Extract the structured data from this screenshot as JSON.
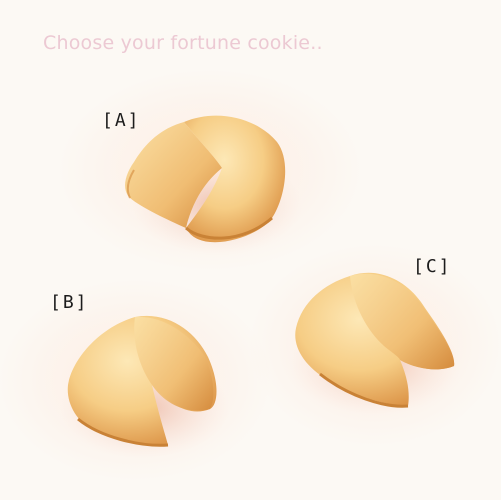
{
  "prompt": "Choose your fortune cookie..",
  "options": [
    {
      "label": "[A]",
      "icon": "fortune-cookie-icon"
    },
    {
      "label": "[B]",
      "icon": "fortune-cookie-icon"
    },
    {
      "label": "[C]",
      "icon": "fortune-cookie-icon"
    }
  ],
  "colors": {
    "background": "#fcf9f4",
    "prompt_text": "#ecc9d3",
    "label_text": "#1c1c1c",
    "cookie_light": "#fbe4ae",
    "cookie_mid": "#f3c27a",
    "cookie_dark": "#d98f3f",
    "cookie_shadow": "#e8a48c"
  }
}
